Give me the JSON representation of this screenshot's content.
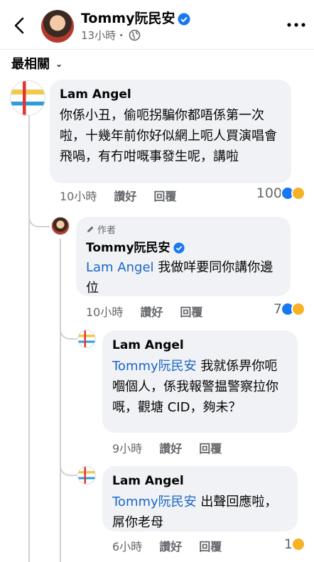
{
  "header": {
    "name": "Tommy阮民安",
    "time": "13小時・"
  },
  "sort": {
    "label": "最相關"
  },
  "comments": [
    {
      "author": "Lam Angel",
      "text": "你係小丑，偷呃拐騙你都唔係第一次啦，十幾年前你好似網上呃人買演唱會飛喎，有冇咁嘅事發生呢，講啦",
      "time": "10小時",
      "like": "讚好",
      "reply": "回覆",
      "reaction_count": "100"
    },
    {
      "badge": "作者",
      "author": "Tommy阮民安",
      "mention": "Lam Angel",
      "text": " 我做咩要同你講你邊位",
      "time": "10小時",
      "like": "讚好",
      "reply": "回覆",
      "reaction_count": "7"
    },
    {
      "author": "Lam Angel",
      "mention": "Tommy阮民安",
      "text": " 我就係畀你呃嗰個人，係我報警揾警察拉你嘅，觀塘 CID，夠未？",
      "time": "9小時",
      "like": "讚好",
      "reply": "回覆"
    },
    {
      "author": "Lam Angel",
      "mention": "Tommy阮民安",
      "text": " 出聲回應啦，屌你老母",
      "time": "6小時",
      "like": "讚好",
      "reply": "回覆",
      "reaction_count": "1"
    }
  ],
  "colors": {
    "mention": "#1b66c9",
    "bubble": "#f0f2f5",
    "like": "#1877f2",
    "haha": "#f7b125"
  },
  "icons": {
    "back": "chevron-left-icon",
    "more": "more-dots-icon",
    "globe": "globe-icon",
    "verified": "verified-badge-icon",
    "pencil": "pencil-icon"
  }
}
